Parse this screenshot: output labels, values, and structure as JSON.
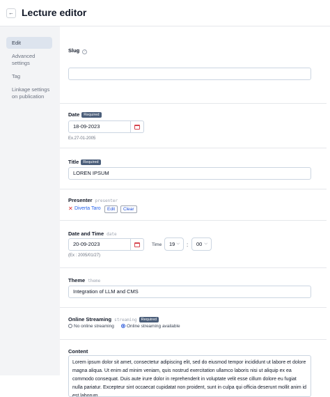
{
  "header": {
    "back_glyph": "←",
    "title": "Lecture editor"
  },
  "sidebar": {
    "items": [
      {
        "label": "Edit"
      },
      {
        "label": "Advanced settings"
      },
      {
        "label": "Tag"
      },
      {
        "label": "Linkage settings on publication"
      }
    ]
  },
  "fields": {
    "slug": {
      "label": "Slug",
      "help": "?",
      "value": ""
    },
    "date": {
      "label": "Date",
      "badge": "Required",
      "value": "18-09-2023",
      "hint": "Ex.27-01-2005"
    },
    "title": {
      "label": "Title",
      "badge": "Required",
      "value": "LOREN IPSUM"
    },
    "presenter": {
      "label": "Presenter",
      "key": "presenter",
      "remove_glyph": "✕",
      "name": "Diverta Taro",
      "edit_label": "Edit",
      "clear_label": "Clear"
    },
    "date_time": {
      "label": "Date and Time",
      "key": "date",
      "value": "20-09-2023",
      "time_label": "Time",
      "hour": "19",
      "separator": ":",
      "minute": "00",
      "chevron": "⌵",
      "hint": "(Ex : 2005/01/27)"
    },
    "theme": {
      "label": "Theme",
      "key": "theme",
      "value": "Integration of LLM and CMS"
    },
    "online_streaming": {
      "label": "Online Streaming",
      "key": "streaming",
      "badge": "Required",
      "option_off": "No online streaming",
      "option_on": "Online streaming available",
      "selected": "option_on"
    },
    "content": {
      "label": "Content",
      "value": "Lorem ipsum dolor sit amet, consectetur adipiscing elit, sed do eiusmod tempor incididunt ut labore et dolore magna aliqua. Ut enim ad minim veniam, quis nostrud exercitation ullamco laboris nisi ut aliquip ex ea commodo consequat. Duis aute irure dolor in reprehenderit in voluptate velit esse cillum dolore eu fugiat nulla pariatur. Excepteur sint occaecat cupidatat non proident, sunt in culpa qui officia deserunt mollit anim id est laborum."
    }
  },
  "colors": {
    "accent": "#2563eb",
    "badge": "#4b5e7a",
    "sidebar_active": "#dde4ee",
    "calendar_icon": "#d6454f"
  }
}
